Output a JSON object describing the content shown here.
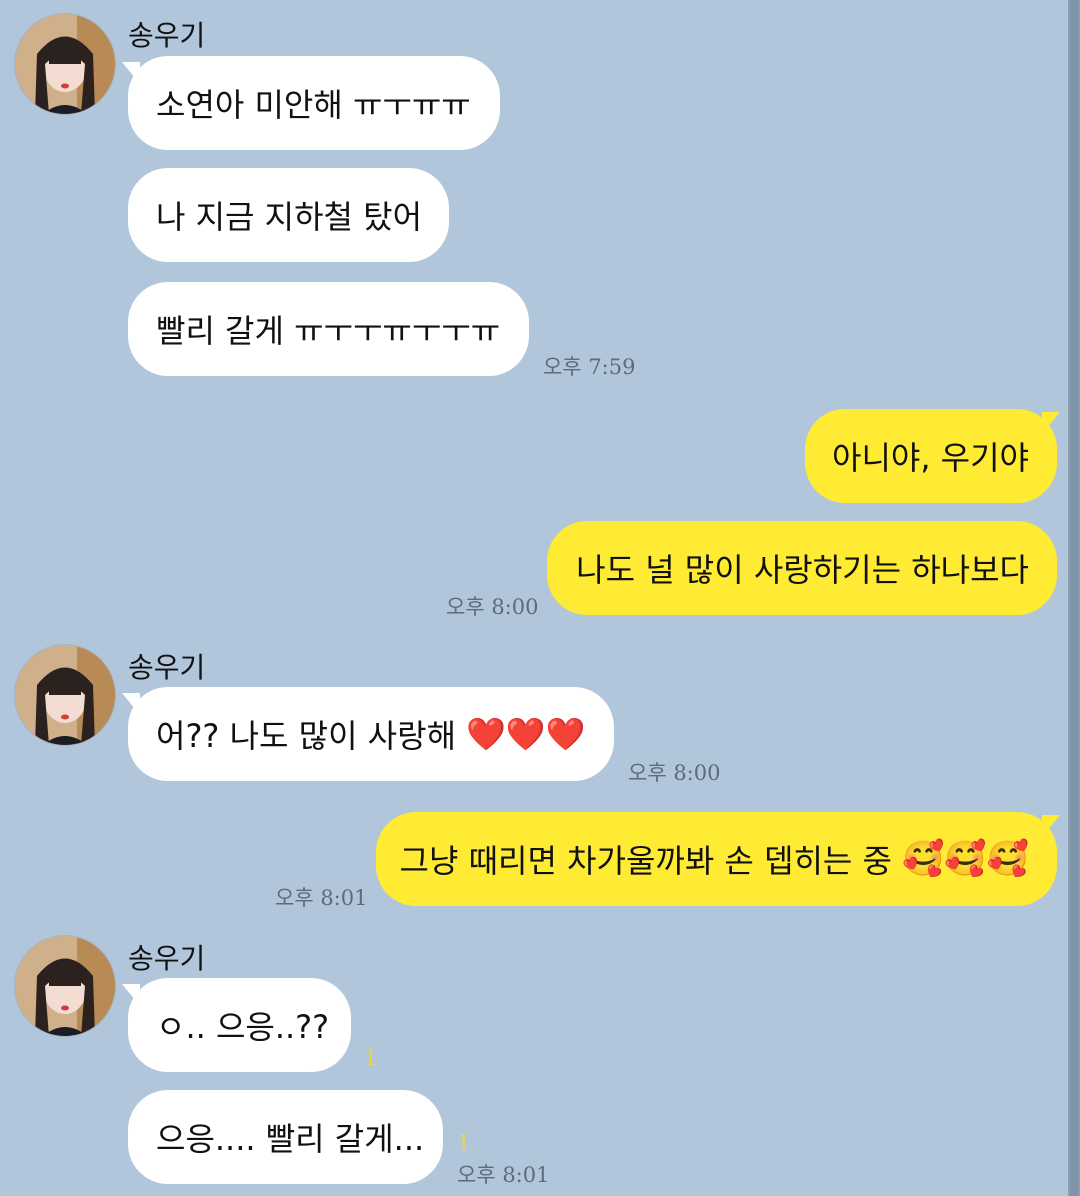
{
  "colors": {
    "background": "#b1c6da",
    "incoming_bubble": "#ffffff",
    "outgoing_bubble": "#ffeb33",
    "unread_count": "#e7d84a"
  },
  "messages": {
    "group1": {
      "sender": "송우기",
      "m1": "소연아 미안해 ㅠㅜㅠㅠ",
      "m2": "나 지금 지하철 탔어",
      "m3": "빨리 갈게 ㅠㅜㅜㅠㅜㅜㅠ",
      "time": "오후 7:59"
    },
    "group2": {
      "m1": "아니야, 우기야",
      "m2": "나도 널 많이 사랑하기는 하나보다",
      "time": "오후 8:00"
    },
    "group3": {
      "sender": "송우기",
      "m1_text": "어?? 나도 많이 사랑해",
      "m1_emoji": "❤️❤️❤️",
      "time": "오후 8:00"
    },
    "group4": {
      "m1_text": "그냥 때리면 차가울까봐 손 뎁히는 중",
      "m1_emoji": "🥰🥰🥰",
      "time": "오후 8:01"
    },
    "group5": {
      "sender": "송우기",
      "m1": "ㅇ.. 으응..??",
      "m1_unread": "1",
      "m2": "으응.... 빨리 갈게...",
      "m2_unread": "1",
      "time": "오후 8:01"
    }
  }
}
